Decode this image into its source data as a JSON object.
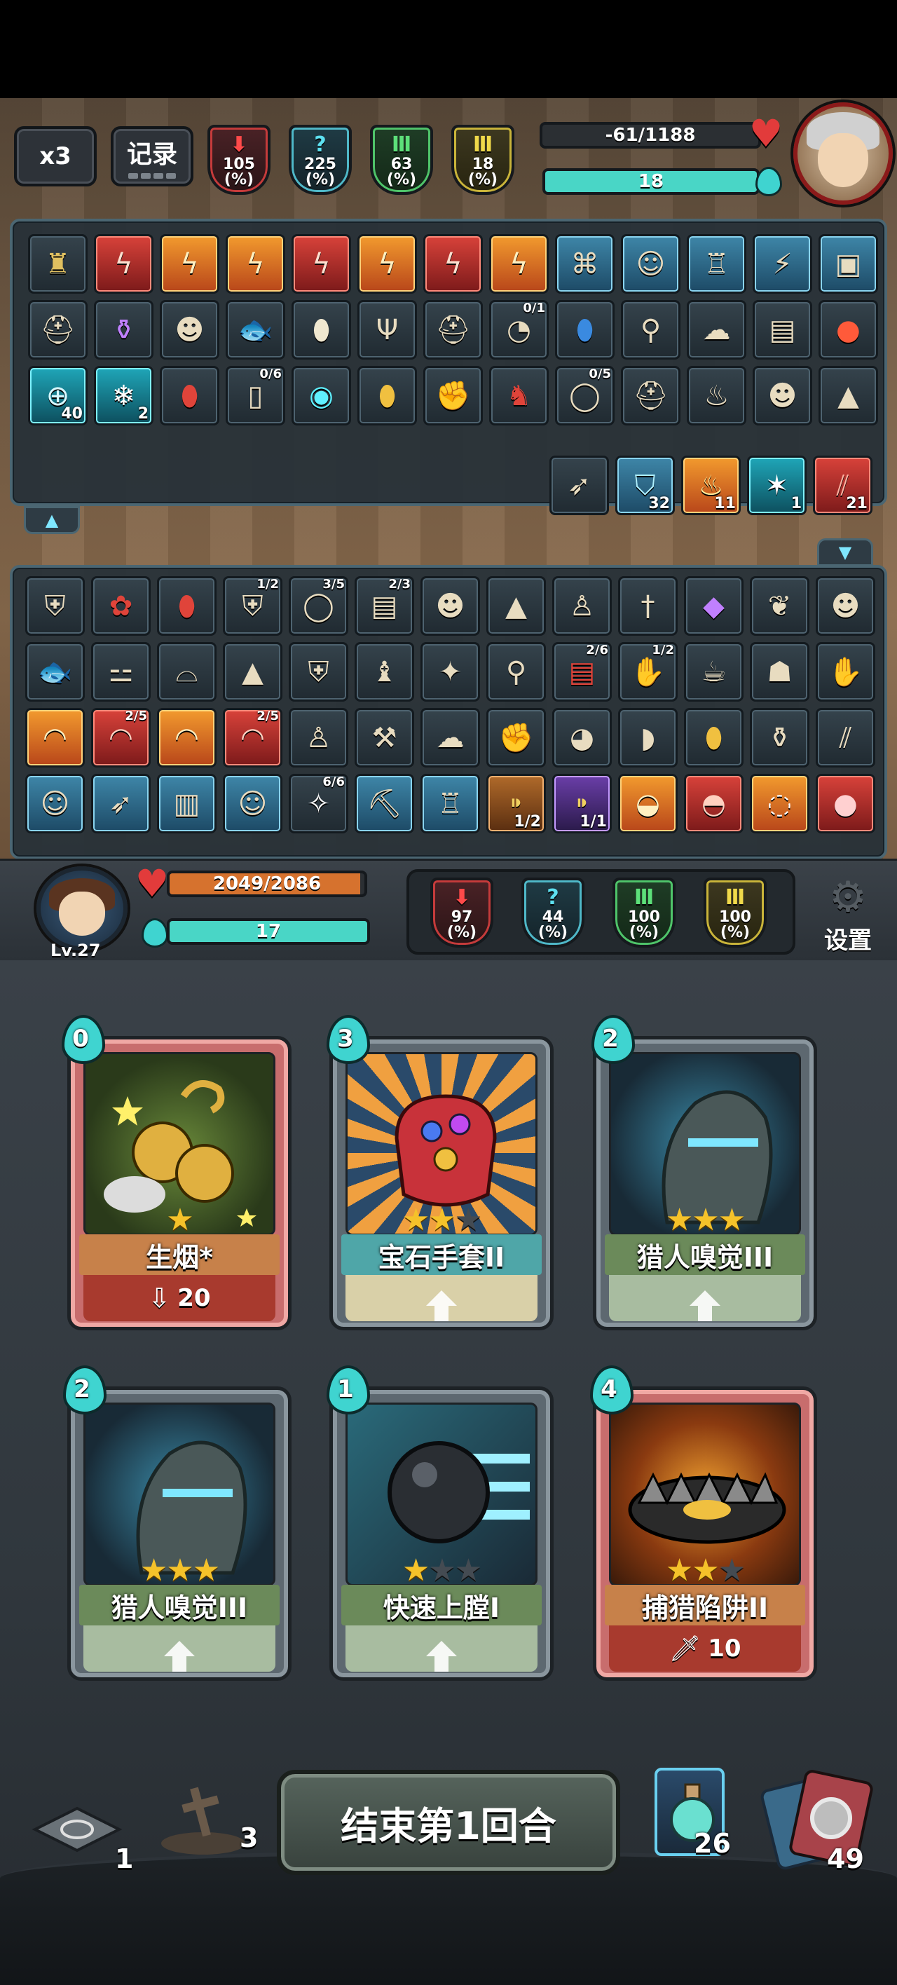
{
  "enemy": {
    "speed_label": "x3",
    "log_label": "记录",
    "stats": [
      {
        "id": "attack",
        "value": "105",
        "unit": "(%)",
        "color": "#c53b3b",
        "icon": "red-down-arrow-icon"
      },
      {
        "id": "crit",
        "value": "225",
        "unit": "(%)",
        "color": "#4fb8c8",
        "icon": "question-mark-icon"
      },
      {
        "id": "defense",
        "value": "63",
        "unit": "(%)",
        "color": "#4fc46a",
        "icon": "pillar-icon"
      },
      {
        "id": "dodge",
        "value": "18",
        "unit": "(%)",
        "color": "#c9b43a",
        "icon": "pillar-icon"
      }
    ],
    "hp_text": "-61/1188",
    "hp_fraction": 0.0,
    "energy_text": "18",
    "energy_fraction": 1.0
  },
  "enemy_items": {
    "row1": [
      {
        "icon": "golden-statue-icon",
        "style": "normal"
      },
      {
        "icon": "red-rune-icon",
        "style": "redslot"
      },
      {
        "icon": "orange-rune-icon",
        "style": "orange"
      },
      {
        "icon": "orange-rune-icon",
        "style": "orange"
      },
      {
        "icon": "red-rune-icon",
        "style": "redslot"
      },
      {
        "icon": "orange-rune-icon",
        "style": "orange"
      },
      {
        "icon": "red-rune-icon",
        "style": "redslot"
      },
      {
        "icon": "orange-rune-icon",
        "style": "orange"
      },
      {
        "icon": "blue-sigil-icon",
        "style": "blue"
      },
      {
        "icon": "blue-mask-icon",
        "style": "blue"
      },
      {
        "icon": "blue-tower-icon",
        "style": "blue"
      },
      {
        "icon": "blue-crack-icon",
        "style": "blue"
      },
      {
        "icon": "blue-chest-icon",
        "style": "blue"
      }
    ],
    "row2": [
      {
        "icon": "helmet-icon",
        "style": "normal"
      },
      {
        "icon": "potion-icon",
        "style": "normal"
      },
      {
        "icon": "gas-mask-icon",
        "style": "normal"
      },
      {
        "icon": "fish-icon",
        "style": "normal"
      },
      {
        "icon": "surfboard-icon",
        "style": "normal"
      },
      {
        "icon": "trident-icon",
        "style": "normal"
      },
      {
        "icon": "knight-helmet-icon",
        "style": "normal"
      },
      {
        "icon": "pacifier-icon",
        "style": "normal",
        "frac": "0/1"
      },
      {
        "icon": "blue-surfboard-icon",
        "style": "normal"
      },
      {
        "icon": "sack-icon",
        "style": "normal"
      },
      {
        "icon": "ghost-icon",
        "style": "normal"
      },
      {
        "icon": "spellbook-icon",
        "style": "normal"
      },
      {
        "icon": "fruit-icon",
        "style": "normal"
      }
    ],
    "row3": [
      {
        "icon": "crosshair-icon",
        "style": "cyan",
        "badge": "40"
      },
      {
        "icon": "snowflake-icon",
        "style": "cyan",
        "badge": "2"
      },
      {
        "icon": "red-surfboard-icon",
        "style": "normal"
      },
      {
        "icon": "scroll-icon",
        "style": "normal",
        "frac": "0/6"
      },
      {
        "icon": "crystal-orb-icon",
        "style": "normal"
      },
      {
        "icon": "yellow-surfboard-icon",
        "style": "normal"
      },
      {
        "icon": "boxing-glove-icon",
        "style": "normal"
      },
      {
        "icon": "red-monster-icon",
        "style": "normal"
      },
      {
        "icon": "ring-icon",
        "style": "normal",
        "frac": "0/5"
      },
      {
        "icon": "knight-helmet-icon",
        "style": "normal"
      },
      {
        "icon": "meat-icon",
        "style": "normal"
      },
      {
        "icon": "villager-icon",
        "style": "normal"
      },
      {
        "icon": "rice-ball-icon",
        "style": "normal"
      }
    ],
    "row4": [
      {
        "icon": "crossbow-icon",
        "style": "normal"
      },
      {
        "icon": "blue-shield-icon",
        "style": "blue",
        "badge": "32"
      },
      {
        "icon": "flame-icon",
        "style": "orange",
        "badge": "11"
      },
      {
        "icon": "lightning-icon",
        "style": "cyan",
        "badge": "1"
      },
      {
        "icon": "claw-slash-icon",
        "style": "redslot",
        "badge": "21"
      }
    ]
  },
  "player_items": {
    "row1": [
      {
        "icon": "armor-icon"
      },
      {
        "icon": "rose-icon"
      },
      {
        "icon": "red-surfboard-icon"
      },
      {
        "icon": "chest-armor-icon",
        "frac": "1/2"
      },
      {
        "icon": "ring-icon",
        "frac": "3/5"
      },
      {
        "icon": "spellbook-icon",
        "frac": "2/3"
      },
      {
        "icon": "gas-mask-icon"
      },
      {
        "icon": "cone-hat-icon"
      },
      {
        "icon": "doll-icon"
      },
      {
        "icon": "dagger-icon"
      },
      {
        "icon": "gem-cluster-icon"
      },
      {
        "icon": "wings-icon"
      },
      {
        "icon": "gas-mask-icon"
      }
    ],
    "row2": [
      {
        "icon": "fish-icon"
      },
      {
        "icon": "bone-icon"
      },
      {
        "icon": "boot-icon"
      },
      {
        "icon": "rice-ball-icon"
      },
      {
        "icon": "vest-icon"
      },
      {
        "icon": "creature-icon"
      },
      {
        "icon": "ice-cream-icon"
      },
      {
        "icon": "broom-icon"
      },
      {
        "icon": "red-book-icon",
        "frac": "2/6"
      },
      {
        "icon": "gauntlet-icon",
        "frac": "1/2"
      },
      {
        "icon": "teacup-icon"
      },
      {
        "icon": "hood-icon"
      },
      {
        "icon": "gauntlet-icon"
      }
    ],
    "row3": [
      {
        "icon": "orange-scroll-icon",
        "style": "orange"
      },
      {
        "icon": "red-scroll-icon",
        "style": "redslot",
        "frac": "2/5"
      },
      {
        "icon": "orange-scroll-icon",
        "style": "orange"
      },
      {
        "icon": "red-scroll-icon",
        "style": "redslot",
        "frac": "2/5"
      },
      {
        "icon": "figurine-icon"
      },
      {
        "icon": "axe-icon"
      },
      {
        "icon": "ghost-icon"
      },
      {
        "icon": "boxing-glove-icon"
      },
      {
        "icon": "owl-icon"
      },
      {
        "icon": "ham-icon"
      },
      {
        "icon": "yellow-surfboard-icon"
      },
      {
        "icon": "jar-icon"
      },
      {
        "icon": "claw-icon"
      }
    ],
    "row4": [
      {
        "icon": "blue-face-icon",
        "style": "blue"
      },
      {
        "icon": "blue-bow-icon",
        "style": "blue"
      },
      {
        "icon": "blue-piano-icon",
        "style": "blue"
      },
      {
        "icon": "blue-mask-icon",
        "style": "blue"
      },
      {
        "icon": "white-bird-icon",
        "style": "normal",
        "frac": "6/6"
      },
      {
        "icon": "blue-pickaxe-icon",
        "style": "blue"
      },
      {
        "icon": "blue-statue-icon",
        "style": "blue"
      },
      {
        "icon": "bullet-icon",
        "style": "brown",
        "badge": "1/2"
      },
      {
        "icon": "purple-bullet-icon",
        "style": "purple",
        "badge": "1/1"
      },
      {
        "icon": "orange-swirl-icon",
        "style": "orange"
      },
      {
        "icon": "red-swirl-icon",
        "style": "redslot"
      },
      {
        "icon": "orange-ring-icon",
        "style": "orange"
      },
      {
        "icon": "red-orb-icon",
        "style": "redslot"
      }
    ]
  },
  "player": {
    "level": "Lv.27",
    "hp_text": "2049/2086",
    "hp_fraction": 0.98,
    "energy_text": "17",
    "energy_fraction": 1.0,
    "stats": [
      {
        "id": "attack",
        "value": "97",
        "unit": "(%)",
        "color": "#c53b3b"
      },
      {
        "id": "crit",
        "value": "44",
        "unit": "(%)",
        "color": "#4fb8c8"
      },
      {
        "id": "defense",
        "value": "100",
        "unit": "(%)",
        "color": "#4fc46a"
      },
      {
        "id": "dodge",
        "value": "100",
        "unit": "(%)",
        "color": "#c9b43a"
      }
    ],
    "settings_label": "设置"
  },
  "cards": [
    {
      "cost": "0",
      "name": "生烟*",
      "stars": 1,
      "max_stars": 1,
      "footer_value": "20",
      "footer_icon": "down-arrow-icon",
      "art": "golden-bells-art",
      "frame": "pink"
    },
    {
      "cost": "3",
      "name": "宝石手套II",
      "stars": 2,
      "max_stars": 3,
      "footer_value": "",
      "footer_icon": "up-arrow-icon",
      "art": "gem-gauntlet-art",
      "frame": "normal"
    },
    {
      "cost": "2",
      "name": "猎人嗅觉III",
      "stars": 3,
      "max_stars": 3,
      "footer_value": "",
      "footer_icon": "up-arrow-icon",
      "art": "hunter-scent-art",
      "frame": "normal"
    },
    {
      "cost": "2",
      "name": "猎人嗅觉III",
      "stars": 3,
      "max_stars": 3,
      "footer_value": "",
      "footer_icon": "up-arrow-icon",
      "art": "hunter-scent-art",
      "frame": "normal"
    },
    {
      "cost": "1",
      "name": "快速上膛I",
      "stars": 1,
      "max_stars": 3,
      "footer_value": "",
      "footer_icon": "up-arrow-icon",
      "art": "quick-load-art",
      "frame": "normal"
    },
    {
      "cost": "4",
      "name": "捕猎陷阱II",
      "stars": 2,
      "max_stars": 3,
      "footer_value": "10",
      "footer_icon": "sword-icon",
      "art": "bear-trap-art",
      "frame": "pink"
    }
  ],
  "bottom": {
    "discard_count": "1",
    "grave_count": "3",
    "end_turn_label": "结束第1回合",
    "potion_count": "26",
    "draw_count": "49"
  }
}
